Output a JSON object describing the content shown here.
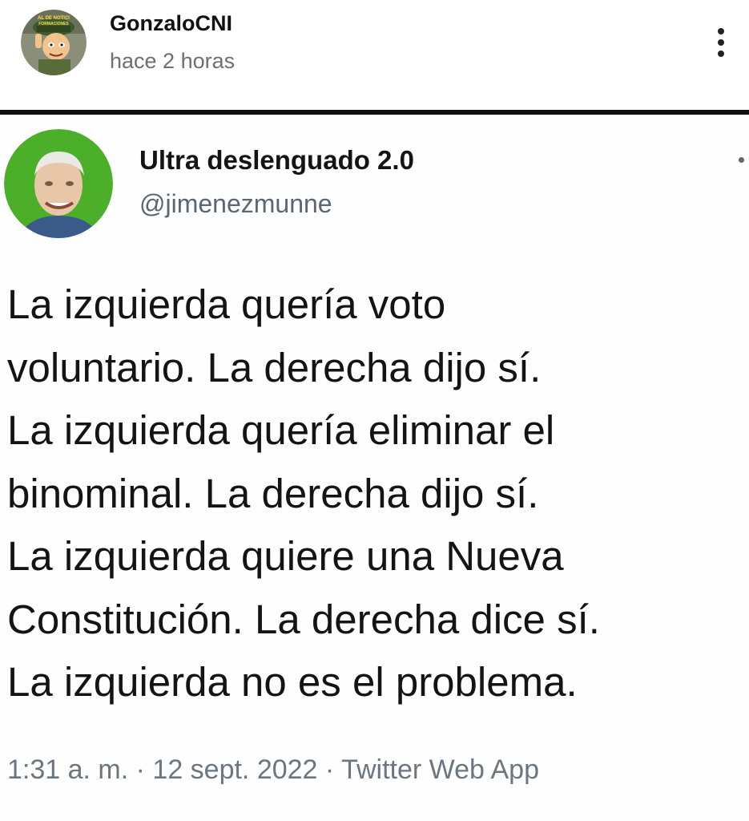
{
  "post": {
    "author": "GonzaloCNI",
    "time": "hace 2 horas",
    "avatar_icon": "cartoon-soldier-avatar",
    "menu_icon": "kebab-menu-icon"
  },
  "tweet": {
    "display_name": "Ultra deslenguado 2.0",
    "handle": "@jimenezmunne",
    "avatar_icon": "man-portrait-avatar",
    "body_lines": [
      "La izquierda quería voto",
      "voluntario. La derecha dijo sí.",
      "La izquierda quería eliminar el",
      "binominal. La derecha dijo sí.",
      "La izquierda quiere una Nueva",
      "Constitución. La derecha dice sí.",
      "La izquierda no es el problema."
    ],
    "meta": "1:31 a. m. · 12 sept. 2022 · Twitter Web App"
  },
  "colors": {
    "text": "#111111",
    "muted": "#6f6f6f",
    "handle": "#5b6670",
    "divider": "#111111",
    "avatar_green": "#4caf2a"
  }
}
